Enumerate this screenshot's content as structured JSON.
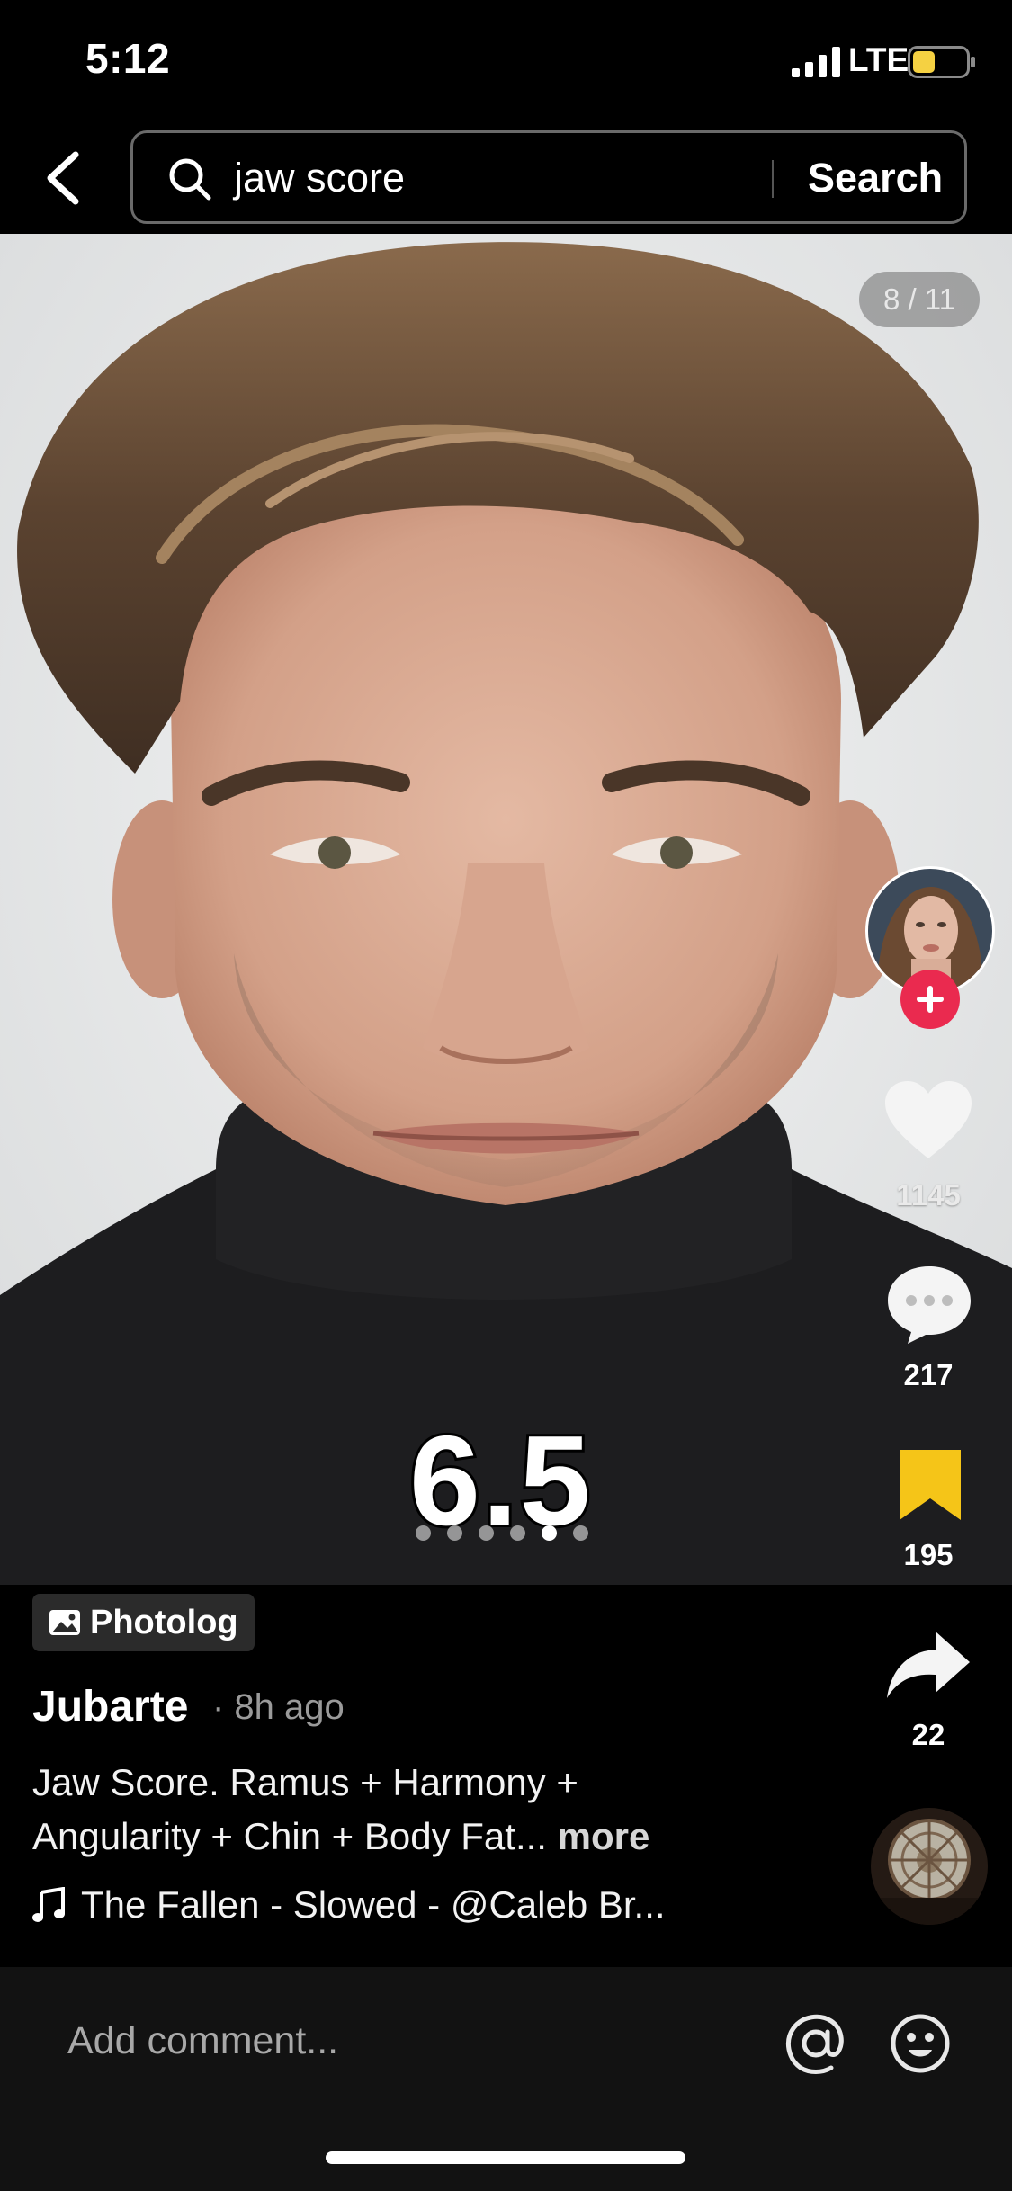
{
  "status_bar": {
    "time": "5:12",
    "network": "LTE",
    "icons": [
      "signal-icon",
      "battery-icon"
    ],
    "battery_color": "#f5d142"
  },
  "search": {
    "query": "jaw score",
    "submit_label": "Search",
    "icons": [
      "back-chevron-icon",
      "search-icon"
    ]
  },
  "post": {
    "page_counter": "8 / 11",
    "score_overlay": "6.5",
    "carousel": {
      "dot_count": 6,
      "active_index": 4
    },
    "badge_label": "Photolog",
    "author": "Jubarte",
    "time_ago": "· 8h ago",
    "caption": "Jaw Score. Ramus + Harmony + Angularity + Chin + Body Fat...",
    "caption_more": "more",
    "music": "The Fallen - Slowed - @Caleb Br..."
  },
  "actions": {
    "likes": "1145",
    "comments": "217",
    "saves": "195",
    "shares": "22",
    "bookmark_color": "#f5c518",
    "follow_color": "#ea2a4f"
  },
  "comment_bar": {
    "placeholder": "Add comment...",
    "icons": [
      "mention-icon",
      "emoji-icon"
    ]
  }
}
